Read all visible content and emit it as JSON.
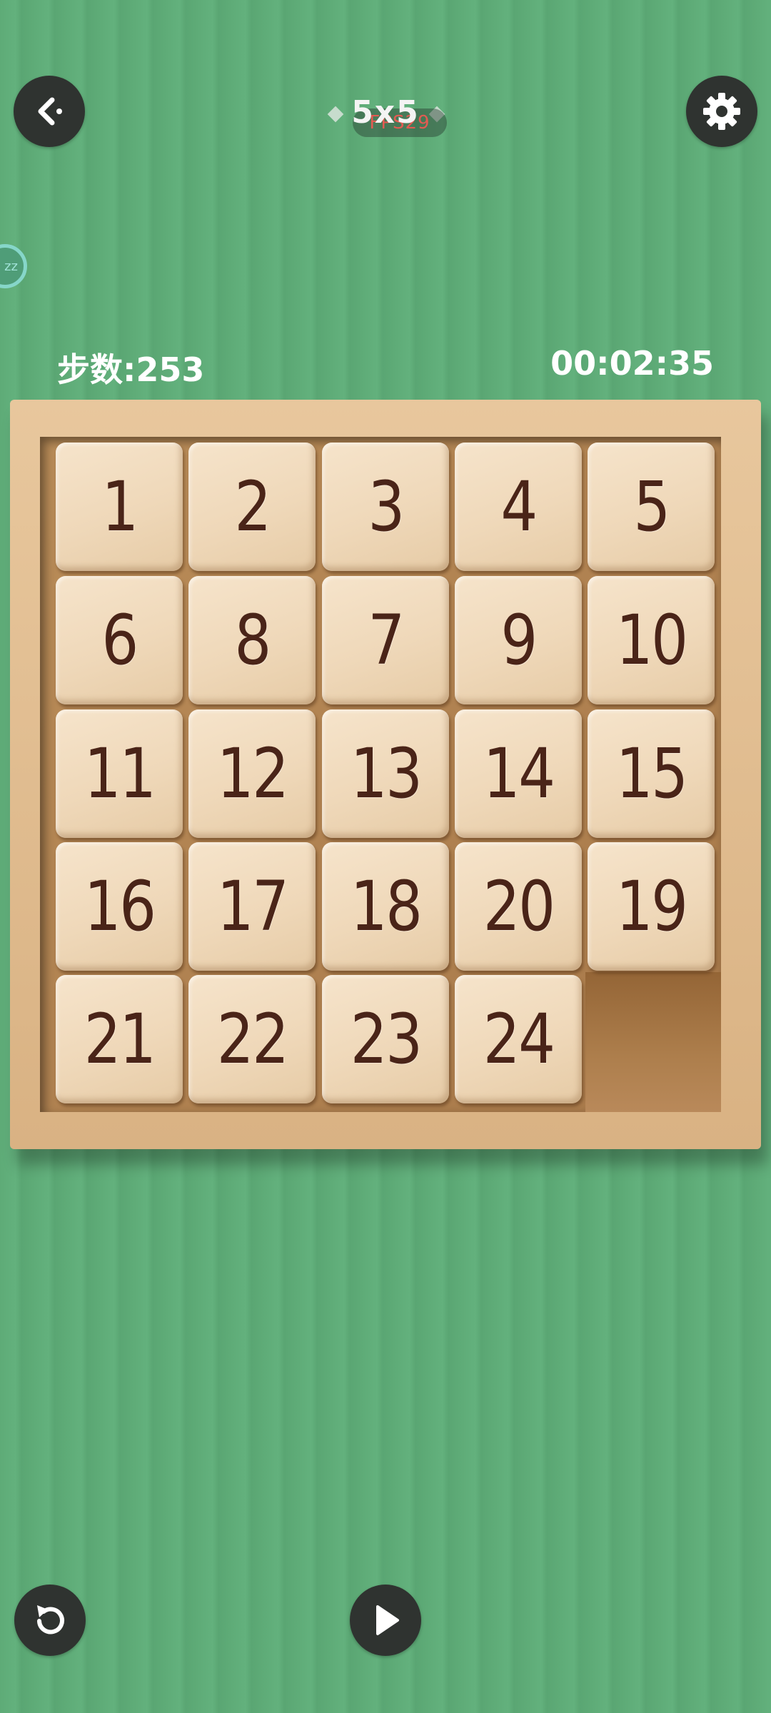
{
  "header": {
    "title": "5x5",
    "pill_text": "FPS29",
    "back_icon": "back-arrow-icon",
    "settings_icon": "gear-icon"
  },
  "side_badge": {
    "text": "zz"
  },
  "stats": {
    "moves": "步数:253",
    "time": "00:02:35"
  },
  "board": {
    "tiles": [
      "1",
      "2",
      "3",
      "4",
      "5",
      "6",
      "8",
      "7",
      "9",
      "10",
      "11",
      "12",
      "13",
      "14",
      "15",
      "16",
      "17",
      "18",
      "20",
      "19",
      "21",
      "22",
      "23",
      "24"
    ],
    "empty_slot": 25
  },
  "footer": {
    "restart_icon": "restart-icon",
    "play_icon": "play-icon"
  },
  "colors": {
    "background": "#5eac78",
    "button": "#2f3330",
    "tile": "#f1dcbf",
    "tile_text": "#4a2418",
    "frame": "#e2bf93"
  }
}
